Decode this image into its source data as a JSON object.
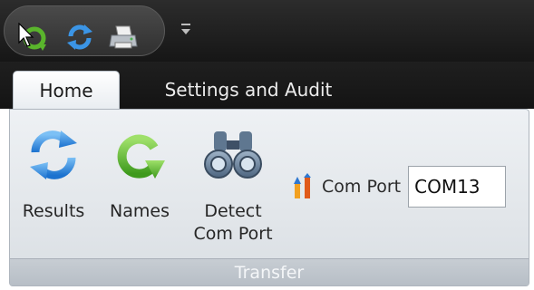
{
  "quick_access": {
    "items": [
      {
        "icon": "names-arrow-icon"
      },
      {
        "icon": "refresh-icon"
      },
      {
        "icon": "print-icon"
      }
    ],
    "dropdown_icon": "customize-dropdown-icon"
  },
  "tabs": [
    {
      "label": "Home",
      "active": true
    },
    {
      "label": "Settings and Audit",
      "active": false
    }
  ],
  "ribbon": {
    "buttons": [
      {
        "label": "Results",
        "icon": "refresh-icon"
      },
      {
        "label": "Names",
        "icon": "names-arrow-icon"
      },
      {
        "label_line1": "Detect",
        "label_line2": "Com Port",
        "icon": "binoculars-icon"
      }
    ],
    "com_port": {
      "icon": "com-port-icon",
      "label": "Com Port",
      "value": "COM13"
    },
    "group_caption": "Transfer"
  },
  "colors": {
    "titlebar": "#1f1f1f",
    "ribbon_bg": "#e2e6ea",
    "group_caption_bg": "#bfc5cc",
    "blue_icon": "#2f8be0",
    "green_icon": "#5ab52c"
  }
}
